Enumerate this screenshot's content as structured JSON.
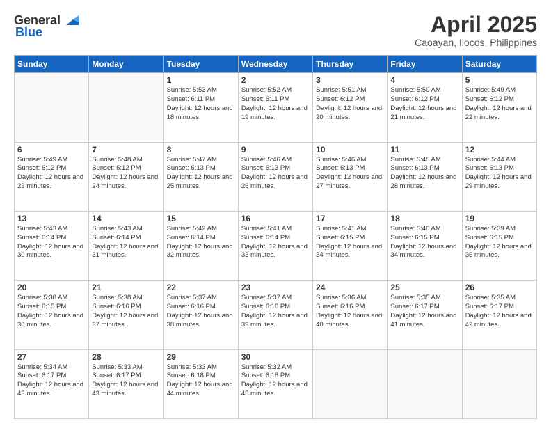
{
  "header": {
    "logo_general": "General",
    "logo_blue": "Blue",
    "title": "April 2025",
    "subtitle": "Caoayan, Ilocos, Philippines"
  },
  "weekdays": [
    "Sunday",
    "Monday",
    "Tuesday",
    "Wednesday",
    "Thursday",
    "Friday",
    "Saturday"
  ],
  "weeks": [
    [
      {
        "day": "",
        "info": ""
      },
      {
        "day": "",
        "info": ""
      },
      {
        "day": "1",
        "info": "Sunrise: 5:53 AM\nSunset: 6:11 PM\nDaylight: 12 hours and 18 minutes."
      },
      {
        "day": "2",
        "info": "Sunrise: 5:52 AM\nSunset: 6:11 PM\nDaylight: 12 hours and 19 minutes."
      },
      {
        "day": "3",
        "info": "Sunrise: 5:51 AM\nSunset: 6:12 PM\nDaylight: 12 hours and 20 minutes."
      },
      {
        "day": "4",
        "info": "Sunrise: 5:50 AM\nSunset: 6:12 PM\nDaylight: 12 hours and 21 minutes."
      },
      {
        "day": "5",
        "info": "Sunrise: 5:49 AM\nSunset: 6:12 PM\nDaylight: 12 hours and 22 minutes."
      }
    ],
    [
      {
        "day": "6",
        "info": "Sunrise: 5:49 AM\nSunset: 6:12 PM\nDaylight: 12 hours and 23 minutes."
      },
      {
        "day": "7",
        "info": "Sunrise: 5:48 AM\nSunset: 6:12 PM\nDaylight: 12 hours and 24 minutes."
      },
      {
        "day": "8",
        "info": "Sunrise: 5:47 AM\nSunset: 6:13 PM\nDaylight: 12 hours and 25 minutes."
      },
      {
        "day": "9",
        "info": "Sunrise: 5:46 AM\nSunset: 6:13 PM\nDaylight: 12 hours and 26 minutes."
      },
      {
        "day": "10",
        "info": "Sunrise: 5:46 AM\nSunset: 6:13 PM\nDaylight: 12 hours and 27 minutes."
      },
      {
        "day": "11",
        "info": "Sunrise: 5:45 AM\nSunset: 6:13 PM\nDaylight: 12 hours and 28 minutes."
      },
      {
        "day": "12",
        "info": "Sunrise: 5:44 AM\nSunset: 6:13 PM\nDaylight: 12 hours and 29 minutes."
      }
    ],
    [
      {
        "day": "13",
        "info": "Sunrise: 5:43 AM\nSunset: 6:14 PM\nDaylight: 12 hours and 30 minutes."
      },
      {
        "day": "14",
        "info": "Sunrise: 5:43 AM\nSunset: 6:14 PM\nDaylight: 12 hours and 31 minutes."
      },
      {
        "day": "15",
        "info": "Sunrise: 5:42 AM\nSunset: 6:14 PM\nDaylight: 12 hours and 32 minutes."
      },
      {
        "day": "16",
        "info": "Sunrise: 5:41 AM\nSunset: 6:14 PM\nDaylight: 12 hours and 33 minutes."
      },
      {
        "day": "17",
        "info": "Sunrise: 5:41 AM\nSunset: 6:15 PM\nDaylight: 12 hours and 34 minutes."
      },
      {
        "day": "18",
        "info": "Sunrise: 5:40 AM\nSunset: 6:15 PM\nDaylight: 12 hours and 34 minutes."
      },
      {
        "day": "19",
        "info": "Sunrise: 5:39 AM\nSunset: 6:15 PM\nDaylight: 12 hours and 35 minutes."
      }
    ],
    [
      {
        "day": "20",
        "info": "Sunrise: 5:38 AM\nSunset: 6:15 PM\nDaylight: 12 hours and 36 minutes."
      },
      {
        "day": "21",
        "info": "Sunrise: 5:38 AM\nSunset: 6:16 PM\nDaylight: 12 hours and 37 minutes."
      },
      {
        "day": "22",
        "info": "Sunrise: 5:37 AM\nSunset: 6:16 PM\nDaylight: 12 hours and 38 minutes."
      },
      {
        "day": "23",
        "info": "Sunrise: 5:37 AM\nSunset: 6:16 PM\nDaylight: 12 hours and 39 minutes."
      },
      {
        "day": "24",
        "info": "Sunrise: 5:36 AM\nSunset: 6:16 PM\nDaylight: 12 hours and 40 minutes."
      },
      {
        "day": "25",
        "info": "Sunrise: 5:35 AM\nSunset: 6:17 PM\nDaylight: 12 hours and 41 minutes."
      },
      {
        "day": "26",
        "info": "Sunrise: 5:35 AM\nSunset: 6:17 PM\nDaylight: 12 hours and 42 minutes."
      }
    ],
    [
      {
        "day": "27",
        "info": "Sunrise: 5:34 AM\nSunset: 6:17 PM\nDaylight: 12 hours and 43 minutes."
      },
      {
        "day": "28",
        "info": "Sunrise: 5:33 AM\nSunset: 6:17 PM\nDaylight: 12 hours and 43 minutes."
      },
      {
        "day": "29",
        "info": "Sunrise: 5:33 AM\nSunset: 6:18 PM\nDaylight: 12 hours and 44 minutes."
      },
      {
        "day": "30",
        "info": "Sunrise: 5:32 AM\nSunset: 6:18 PM\nDaylight: 12 hours and 45 minutes."
      },
      {
        "day": "",
        "info": ""
      },
      {
        "day": "",
        "info": ""
      },
      {
        "day": "",
        "info": ""
      }
    ]
  ]
}
